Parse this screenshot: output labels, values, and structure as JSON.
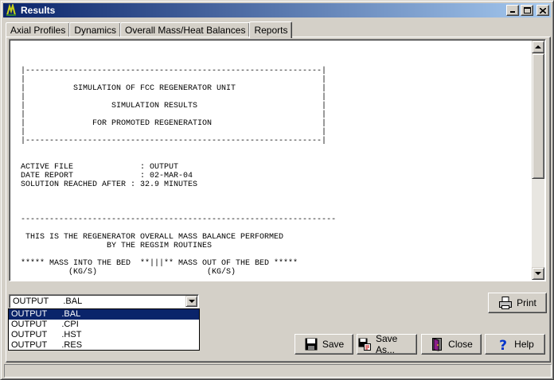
{
  "window": {
    "title": "Results",
    "title_bar_color": "#0a246a",
    "minimize_icon": "minimize-icon",
    "maximize_icon": "maximize-icon",
    "close_icon": "close-icon"
  },
  "tabs": [
    {
      "label": "Axial Profiles",
      "active": false
    },
    {
      "label": "Dynamics",
      "active": false
    },
    {
      "label": "Overall Mass/Heat Balances",
      "active": false
    },
    {
      "label": "Reports",
      "active": true
    }
  ],
  "report": {
    "lines": [
      "|--------------------------------------------------------------|",
      "|                                                              |",
      "|          SIMULATION OF FCC REGENERATOR UNIT                  |",
      "|                                                              |",
      "|                  SIMULATION RESULTS                          |",
      "|                                                              |",
      "|              FOR PROMOTED REGENERATION                       |",
      "|                                                              |",
      "|--------------------------------------------------------------|",
      "",
      "",
      "ACTIVE FILE              : OUTPUT",
      "DATE REPORT              : 02-MAR-04",
      "SOLUTION REACHED AFTER : 32.9 MINUTES",
      "",
      "",
      "",
      "------------------------------------------------------------------",
      "",
      " THIS IS THE REGENERATOR OVERALL MASS BALANCE PERFORMED",
      "                  BY THE REGSIM ROUTINES",
      "",
      "***** MASS INTO THE BED  **|||** MASS OUT OF THE BED *****",
      "          (KG/S)                       (KG/S)"
    ]
  },
  "file_select": {
    "selected": "OUTPUT      .BAL",
    "options": [
      "OUTPUT      .BAL",
      "OUTPUT      .CPI",
      "OUTPUT      .HST",
      "OUTPUT      .RES"
    ]
  },
  "buttons": {
    "print": {
      "label": "Print",
      "icon": "printer-icon"
    },
    "save": {
      "label": "Save",
      "icon": "floppy-disk-icon"
    },
    "save_as": {
      "label": "Save As...",
      "icon": "save-as-icon"
    },
    "close": {
      "label": "Close",
      "icon": "door-icon"
    },
    "help": {
      "label": "Help",
      "icon": "question-mark-icon"
    }
  },
  "status": {
    "text": ""
  }
}
